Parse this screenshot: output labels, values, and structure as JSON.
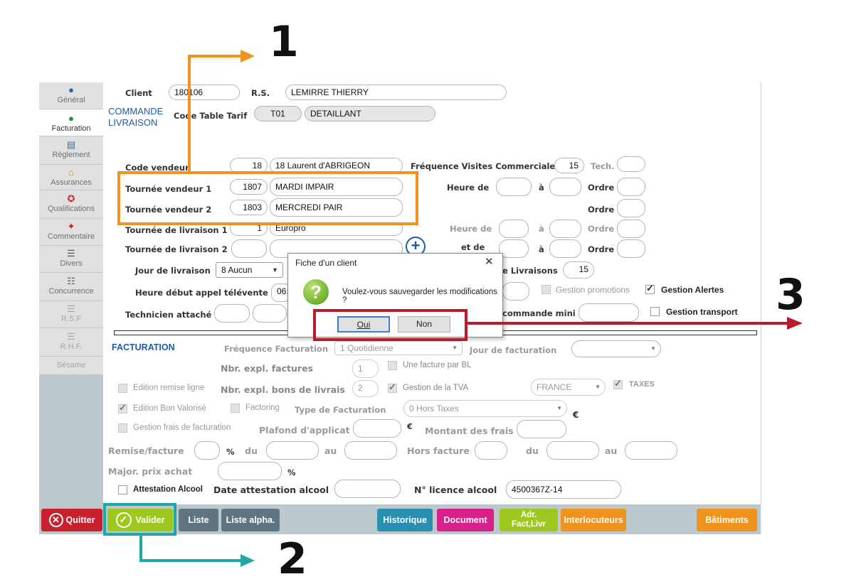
{
  "sidebar": {
    "items": [
      {
        "label": "Général",
        "icon": "person-icon"
      },
      {
        "label": "Facturation",
        "icon": "color-dots-icon"
      },
      {
        "label": "Réglement",
        "icon": "card-icon"
      },
      {
        "label": "Assurances",
        "icon": "bank-icon"
      },
      {
        "label": "Qualifications",
        "icon": "award-icon"
      },
      {
        "label": "Commentaire",
        "icon": "pin-icon"
      },
      {
        "label": "Divers",
        "icon": "sliders-icon"
      },
      {
        "label": "Concurrence",
        "icon": "list-person-icon"
      },
      {
        "label": "R.S.F",
        "icon": "list-icon"
      },
      {
        "label": "R.H.F.",
        "icon": "list-icon"
      },
      {
        "label": "Sésame",
        "icon": ""
      }
    ]
  },
  "header": {
    "client_label": "Client",
    "client_value": "180106",
    "rs_label": "R.S.",
    "rs_value": "LEMIRRE THIERRY",
    "section_commande": "COMMANDE\nLIVRAISON",
    "tarif_label": "Code Table Tarif",
    "tarif_code": "T01",
    "tarif_name": "DETAILLANT"
  },
  "commande": {
    "code_vendeur_label": "Code vendeur",
    "code_vendeur_num": "18",
    "code_vendeur_name": "18 Laurent d'ABRIGEON",
    "freq_label": "Fréquence Visites Commerciale",
    "freq_value": "15",
    "tech_label": "Tech.",
    "tv1_label": "Tournée vendeur 1",
    "tv1_num": "1807",
    "tv1_name": "MARDI IMPAIR",
    "tv2_label": "Tournée vendeur  2",
    "tv2_num": "1803",
    "tv2_name": "MERCREDI PAIR",
    "heure_de_label": "Heure de",
    "a_label": "à",
    "ordre_label": "Ordre",
    "tl1_label": "Tournée de livraison 1",
    "tl1_num": "1",
    "tl1_name": "Europro",
    "tl2_label": "Tournée de livraison 2",
    "et_de_label": "et de",
    "jour_label": "Jour de livraison",
    "jour_value": "8 Aucun",
    "livraisons_label": "e Livraisons",
    "livraisons_value": "15",
    "heure_appel_label": "Heure début appel télévente",
    "heure_appel_value": "06:",
    "gestion_promotions": "Gestion promotions",
    "gestion_alertes": "Gestion Alertes",
    "technicien_label": "Technicien attaché",
    "commande_mini_label": "commande mini",
    "gestion_transport": "Gestion transport"
  },
  "facturation": {
    "section": "FACTURATION",
    "freq_label": "Fréquence Facturation",
    "freq_value": "1 Quotidienne",
    "jour_label": "Jour de facturation",
    "nbr_factures_label": "Nbr. expl.  factures",
    "nbr_factures_value": "1",
    "une_facture": "Une facture par BL",
    "edition_remise": "Edition remise ligne",
    "nbr_bons_label": "Nbr. expl.  bons de livrais",
    "nbr_bons_value": "2",
    "gestion_tva": "Gestion de la TVA",
    "pays": "FRANCE",
    "taxes": "TAXES",
    "edition_bon": "Edition Bon Valorisé",
    "factoring": "Factoring",
    "type_label": "Type de Facturation",
    "type_value": "0  Hors Taxes",
    "euro": "€",
    "gestion_frais": "Gestion frais de facturation",
    "plafond_label": "Plafond d'applicat",
    "montant_label": "Montant des frais",
    "remise_label": "Remise/facture",
    "pct": "%",
    "du": "du",
    "au": "au",
    "hors_facture": "Hors facture",
    "major_label": "Major. prix achat",
    "attestation": "Attestation Alcool",
    "date_attestation": "Date attestation alcool",
    "licence_label": "N° licence alcool",
    "licence_value": "4500367Z-14"
  },
  "buttons": {
    "quitter": "Quitter",
    "valider": "Valider",
    "liste": "Liste",
    "liste_alpha": "Liste alpha.",
    "historique": "Historique",
    "document": "Document",
    "adr": "Adr.\nFact,Livr",
    "interlocuteurs": "Interlocuteurs",
    "batiments": "Bâtiments"
  },
  "dialog": {
    "title": "Fiche d'un client",
    "message": "Voulez-vous sauvegarder les modifications ?",
    "oui": "Oui",
    "non": "Non",
    "close": "✕"
  },
  "annotations": {
    "n1": "1",
    "n2": "2",
    "n3": "3"
  },
  "colors": {
    "orange": "#f0921e",
    "teal": "#1fa6a6",
    "red": "#b71c2c",
    "quitter": "#c8202d",
    "valider": "#9ec81e",
    "liste": "#5f7680",
    "historique": "#2a8fb0",
    "document": "#d8208a",
    "adr": "#9ec81e",
    "interlocuteurs": "#f0921e",
    "batiments": "#f0921e"
  }
}
